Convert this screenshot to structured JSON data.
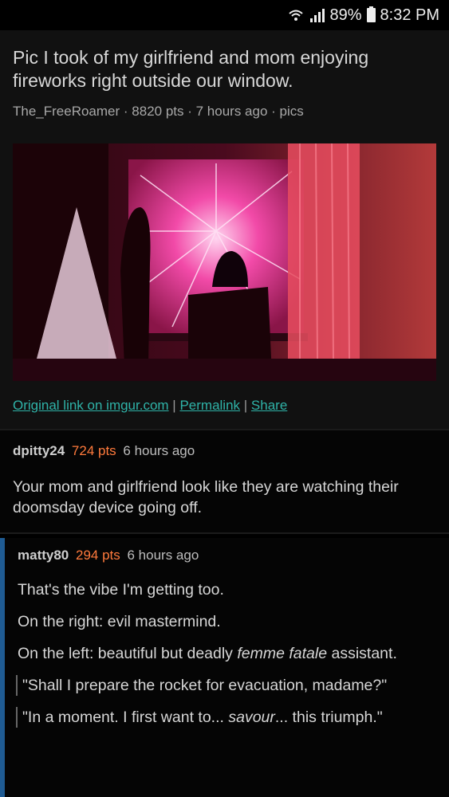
{
  "status": {
    "battery": "89%",
    "time": "8:32 PM"
  },
  "post": {
    "title": "Pic I took of my girlfriend and mom enjoying fireworks right outside our window.",
    "author": "The_FreeRoamer",
    "points": "8820 pts",
    "time": "7 hours ago",
    "subreddit": "pics",
    "sep": " · ",
    "links": {
      "original": "Original link on imgur.com",
      "permalink": "Permalink",
      "share": "Share",
      "pipe": " | "
    }
  },
  "comments": [
    {
      "user": "dpitty24",
      "points": "724 pts",
      "time": "6 hours ago",
      "body": "Your mom and girlfriend look like they are watching their doomsday device going off."
    }
  ],
  "reply": {
    "user": "matty80",
    "points": "294 pts",
    "time": "6 hours ago",
    "p1": "That's the vibe I'm getting too.",
    "p2": "On the right: evil mastermind.",
    "p3_prefix": "On the left: beautiful but deadly ",
    "p3_italic": "femme fatale",
    "p3_suffix": " assistant.",
    "quote1": "\"Shall I prepare the rocket for evacuation, madame?\"",
    "quote2_prefix": "\"In a moment. I first want to... ",
    "quote2_italic": "savour",
    "quote2_suffix": "... this triumph.\""
  },
  "colors": {
    "background": "#000000",
    "link": "#2fb3a8",
    "points": "#ff7a3c",
    "reply_bar": "#1f5b93"
  }
}
